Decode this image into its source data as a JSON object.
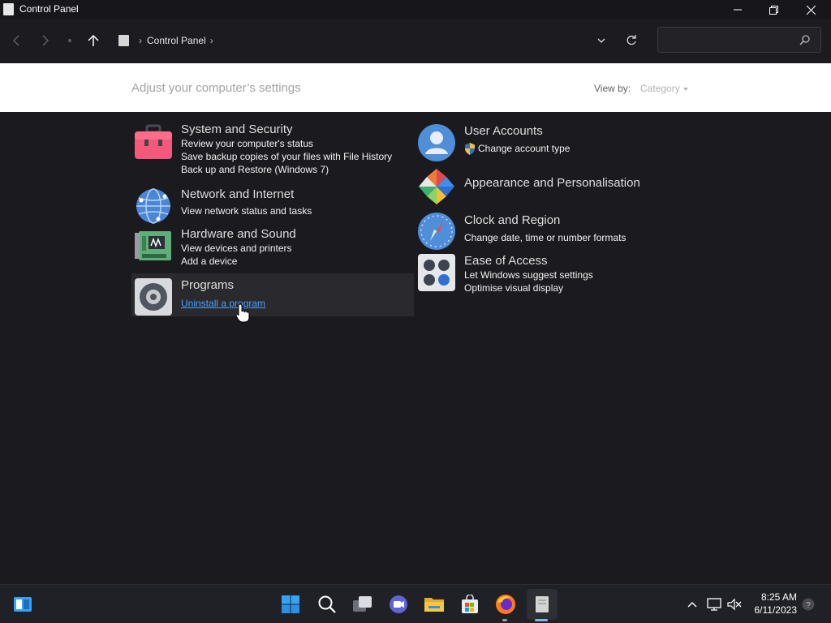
{
  "window": {
    "title": "Control Panel"
  },
  "address": {
    "crumbs": [
      "Control Panel"
    ],
    "search_placeholder": ""
  },
  "header": {
    "heading": "Adjust your computer’s settings",
    "view_by_label": "View by:",
    "view_by_value": "Category"
  },
  "categories": [
    {
      "title": "System and Security",
      "icon": "toolbox-icon",
      "links": [
        "Review your computer's status",
        "Save backup copies of your files with File History",
        "Back up and Restore (Windows 7)"
      ]
    },
    {
      "title": "Network and Internet",
      "icon": "globe-icon",
      "links": [
        "View network status and tasks"
      ]
    },
    {
      "title": "Hardware and Sound",
      "icon": "circuit-board-icon",
      "links": [
        "View devices and printers",
        "Add a device"
      ]
    },
    {
      "title": "Programs",
      "icon": "disc-drive-icon",
      "links": [
        "Uninstall a program"
      ]
    },
    {
      "title": "User Accounts",
      "icon": "user-icon",
      "links": [
        "Change account type"
      ]
    },
    {
      "title": "Appearance and Personalisation",
      "icon": "pinwheel-icon",
      "links": []
    },
    {
      "title": "Clock and Region",
      "icon": "compass-clock-icon",
      "links": [
        "Change date, time or number formats"
      ]
    },
    {
      "title": "Ease of Access",
      "icon": "dots-grid-icon",
      "links": [
        "Let Windows suggest settings",
        "Optimise visual display"
      ]
    }
  ],
  "taskbar": {
    "apps": [
      "widgets-icon",
      "start-icon",
      "search-icon",
      "task-view-icon",
      "chat-icon",
      "file-explorer-icon",
      "store-icon",
      "firefox-icon",
      "control-panel-icon"
    ],
    "time": "8:25 AM",
    "date": "6/11/2023"
  },
  "colors": {
    "link": "#4aa2ff",
    "background": "#1b1a1f",
    "header": "#ffffff"
  }
}
